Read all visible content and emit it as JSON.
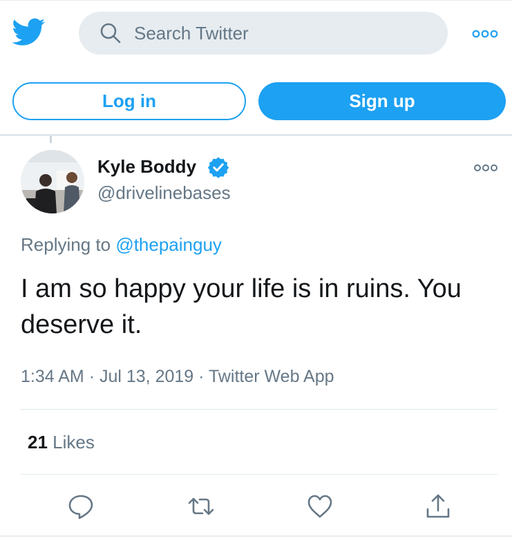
{
  "colors": {
    "brand": "#1da1f2",
    "text": "#14171a",
    "secondary": "#657786",
    "divider": "#e1e8ed",
    "search_bg": "#e6ecf0"
  },
  "header": {
    "logo_icon": "twitter-bird-icon",
    "search": {
      "placeholder": "Search Twitter",
      "value": "",
      "icon": "search-icon"
    },
    "more_icon": "more-options-icon"
  },
  "auth": {
    "login_label": "Log in",
    "signup_label": "Sign up"
  },
  "tweet": {
    "author": {
      "name": "Kyle Boddy",
      "handle": "@drivelinebases",
      "verified_icon": "verified-badge-icon",
      "avatar_icon": "avatar-photo"
    },
    "replying_prefix": "Replying to",
    "replying_to": "@thepainguy",
    "text": "I am so happy your life is in ruins. You deserve it.",
    "time": "1:34 AM",
    "date": "Jul 13, 2019",
    "source": "Twitter Web App",
    "meta_separator": "·",
    "likes_count": "21",
    "likes_label": "Likes"
  },
  "actions": [
    {
      "icon": "reply-icon"
    },
    {
      "icon": "retweet-icon"
    },
    {
      "icon": "like-heart-icon"
    },
    {
      "icon": "share-icon"
    }
  ]
}
